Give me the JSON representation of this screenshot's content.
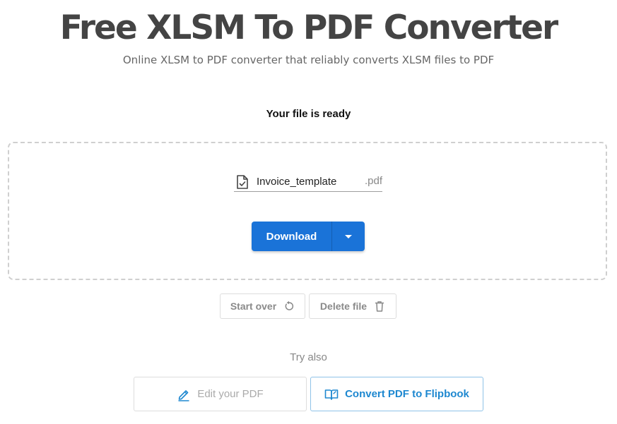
{
  "header": {
    "title": "Free XLSM To PDF Converter",
    "subtitle": "Online XLSM to PDF converter that reliably converts XLSM files to PDF"
  },
  "result": {
    "status_text": "Your file is ready",
    "file_name": "Invoice_template",
    "file_extension": ".pdf",
    "file_icon": "file-check-icon"
  },
  "actions": {
    "download_label": "Download",
    "download_menu_icon": "caret-down-icon",
    "start_over_label": "Start over",
    "start_over_icon": "refresh-icon",
    "delete_label": "Delete file",
    "delete_icon": "trash-icon"
  },
  "try_also": {
    "heading": "Try also",
    "tools": [
      {
        "label": "Edit your PDF",
        "icon": "pencil-icon"
      },
      {
        "label": "Convert PDF to Flipbook",
        "icon": "book-icon"
      }
    ]
  },
  "colors": {
    "primary": "#1a73d8",
    "title": "#444444",
    "link": "#1e88d0"
  }
}
